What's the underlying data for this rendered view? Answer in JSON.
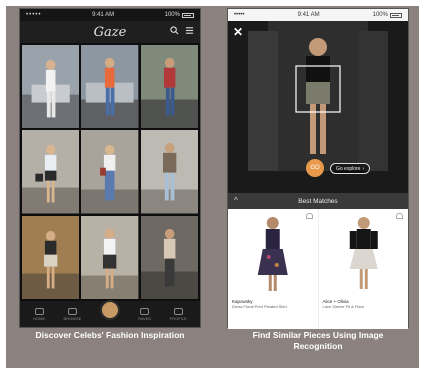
{
  "left_panel": {
    "status": {
      "carrier": "•••••",
      "time": "9:41 AM",
      "battery": "100%"
    },
    "app_logo": "Gaze",
    "tabs": [
      {
        "label": "HOME",
        "icon": "home-icon"
      },
      {
        "label": "BROWSE",
        "icon": "grid-icon"
      },
      {
        "label": "",
        "icon": "camera-icon"
      },
      {
        "label": "SAVED",
        "icon": "heart-icon"
      },
      {
        "label": "PROFILE",
        "icon": "user-icon"
      }
    ],
    "caption": "Discover Celebs' Fashion Inspiration"
  },
  "right_panel": {
    "status": {
      "carrier": "•••••",
      "time": "9:41 AM",
      "battery": "100%"
    },
    "close_label": "✕",
    "search_label": "GO",
    "explore_label": "Go explore",
    "matches_title": "Best Matches",
    "results": [
      {
        "brand": "Kapowsky",
        "desc": "Dress Floral Print Pleated Skirt"
      },
      {
        "brand": "Alice + Olivia",
        "desc": "Lace Sleeve Fit & Flare"
      }
    ],
    "caption": "Find Similar Pieces Using Image Recognition"
  },
  "colors": {
    "background": "#8b8280",
    "accent": "#e89a4a",
    "tab_center": "#c79a63"
  }
}
